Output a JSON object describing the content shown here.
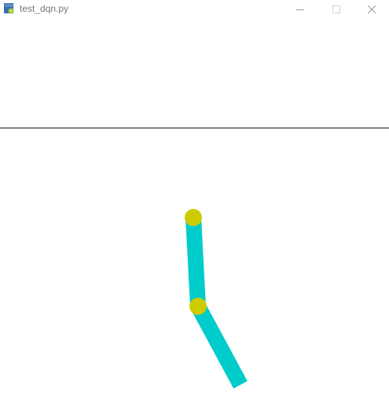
{
  "window": {
    "title": "test_dqn.py"
  },
  "icons": {
    "app": "python-file-icon",
    "minimize": "minimize-icon",
    "maximize": "maximize-icon",
    "close": "close-icon"
  },
  "colors": {
    "link": "#00cccc",
    "joint": "#cccc00",
    "target_line": "#000000",
    "background": "#ffffff",
    "title_text": "#777777"
  }
}
